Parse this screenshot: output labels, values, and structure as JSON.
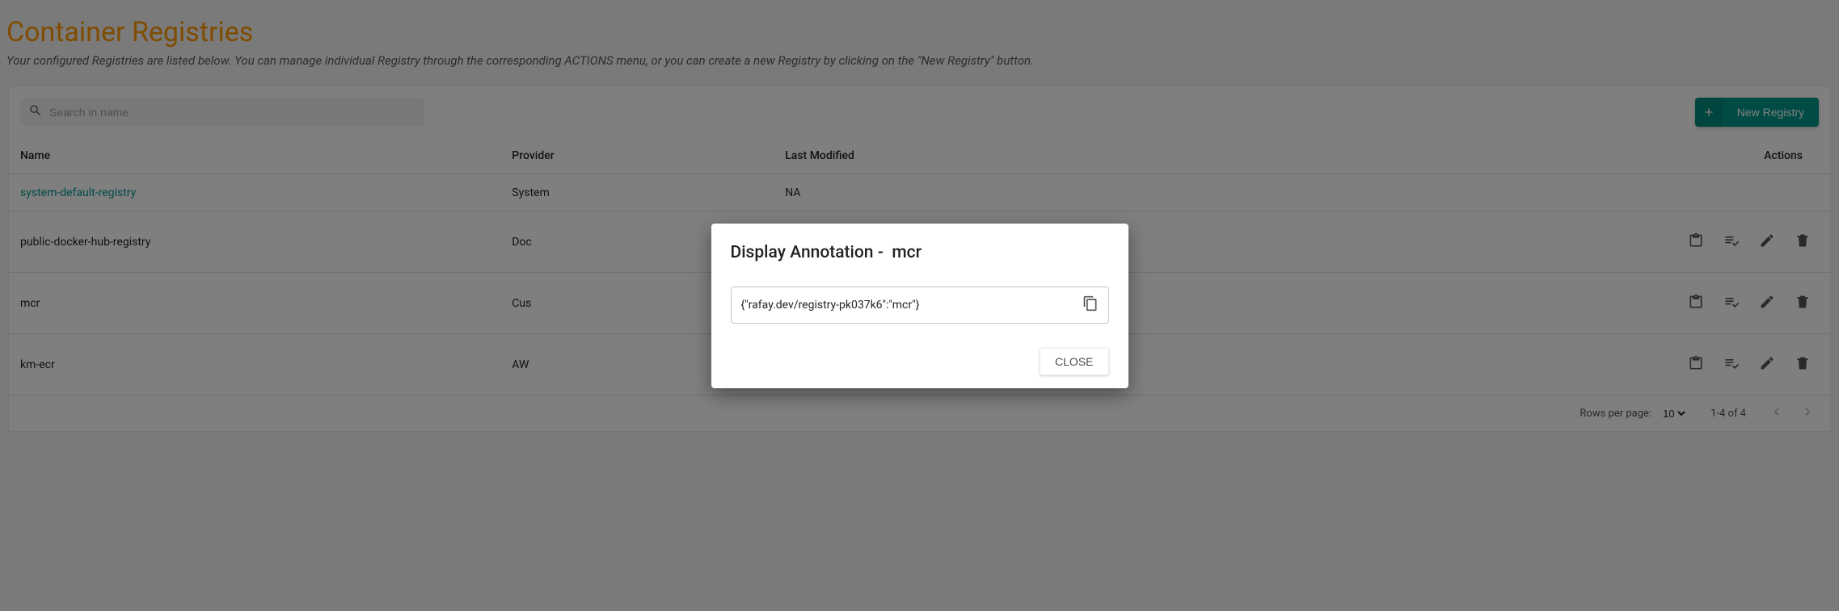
{
  "page": {
    "title": "Container Registries",
    "description": "Your configured Registries are listed below. You can manage individual Registry through the corresponding ACTIONS menu, or you can create a new Registry by clicking on the \"New Registry\" button."
  },
  "toolbar": {
    "search_placeholder": "Search in name",
    "new_registry_label": "New Registry"
  },
  "columns": {
    "name": "Name",
    "provider": "Provider",
    "last_modified": "Last Modified",
    "actions": "Actions"
  },
  "rows": [
    {
      "name": "system-default-registry",
      "provider": "System",
      "last_modified": "NA",
      "link": true,
      "actions": false
    },
    {
      "name": "public-docker-hub-registry",
      "provider": "Doc",
      "last_modified": "",
      "link": false,
      "actions": true
    },
    {
      "name": "mcr",
      "provider": "Cus",
      "last_modified": "",
      "link": false,
      "actions": true
    },
    {
      "name": "km-ecr",
      "provider": "AW",
      "last_modified": "",
      "link": false,
      "actions": true
    }
  ],
  "pagination": {
    "rpp_label": "Rows per page:",
    "rpp_value": "10",
    "range": "1-4 of 4"
  },
  "dialog": {
    "title_prefix": "Display Annotation -",
    "title_name": "mcr",
    "annotation_value": "{\"rafay.dev/registry-pk037k6\":\"mcr\"}",
    "close_label": "CLOSE"
  }
}
